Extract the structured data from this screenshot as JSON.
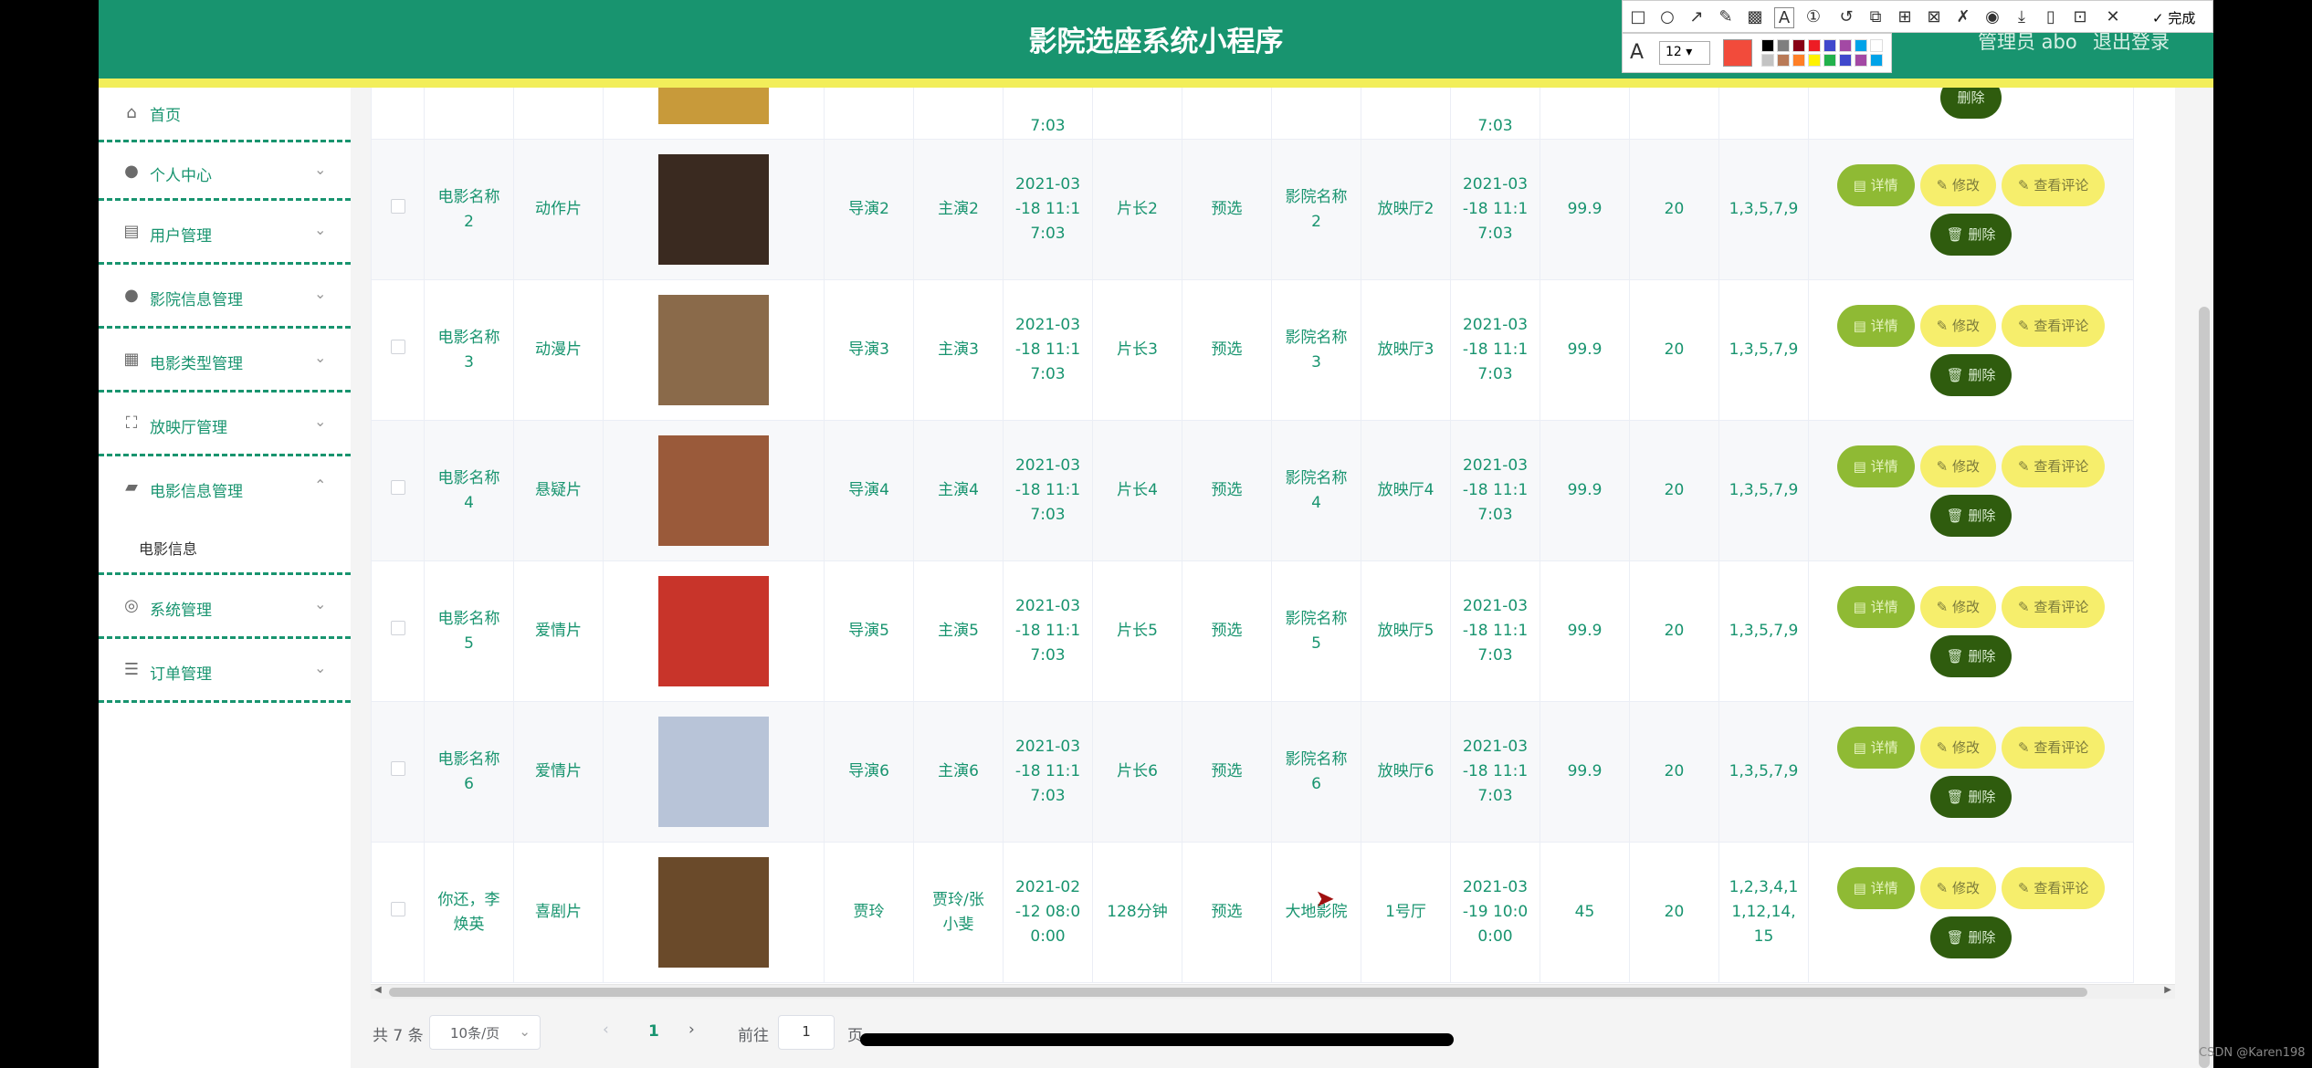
{
  "header": {
    "title": "影院选座系统小程序",
    "admin": "管理员 abo",
    "logout": "退出登录"
  },
  "sidebar": {
    "items": [
      {
        "label": "首页",
        "icon": "home-icon"
      },
      {
        "label": "个人中心",
        "icon": "user-icon"
      },
      {
        "label": "用户管理",
        "icon": "chart-icon"
      },
      {
        "label": "影院信息管理",
        "icon": "person-icon"
      },
      {
        "label": "电影类型管理",
        "icon": "grid-icon"
      },
      {
        "label": "放映厅管理",
        "icon": "fullscreen-icon"
      },
      {
        "label": "电影信息管理",
        "icon": "folder-icon"
      },
      {
        "label": "系统管理",
        "icon": "settings-icon"
      },
      {
        "label": "订单管理",
        "icon": "list-icon"
      }
    ],
    "sub_item": "电影信息"
  },
  "table": {
    "partial_row": {
      "time": "7:03",
      "time2": "7:03"
    },
    "rows": [
      {
        "name": "电影名称\n2",
        "type": "动作片",
        "director": "导演2",
        "actor": "主演2",
        "release": "2021-03\n-18 11:1\n7:03",
        "length": "片长2",
        "status": "预选",
        "cinema": "影院名称\n2",
        "hall": "放映厅2",
        "showtime": "2021-03\n-18 11:1\n7:03",
        "price": "99.9",
        "count": "20",
        "seats": "1,3,5,7,9",
        "poster": "#3a2a20"
      },
      {
        "name": "电影名称\n3",
        "type": "动漫片",
        "director": "导演3",
        "actor": "主演3",
        "release": "2021-03\n-18 11:1\n7:03",
        "length": "片长3",
        "status": "预选",
        "cinema": "影院名称\n3",
        "hall": "放映厅3",
        "showtime": "2021-03\n-18 11:1\n7:03",
        "price": "99.9",
        "count": "20",
        "seats": "1,3,5,7,9",
        "poster": "#8a6a4a"
      },
      {
        "name": "电影名称\n4",
        "type": "悬疑片",
        "director": "导演4",
        "actor": "主演4",
        "release": "2021-03\n-18 11:1\n7:03",
        "length": "片长4",
        "status": "预选",
        "cinema": "影院名称\n4",
        "hall": "放映厅4",
        "showtime": "2021-03\n-18 11:1\n7:03",
        "price": "99.9",
        "count": "20",
        "seats": "1,3,5,7,9",
        "poster": "#9a5a3a"
      },
      {
        "name": "电影名称\n5",
        "type": "爱情片",
        "director": "导演5",
        "actor": "主演5",
        "release": "2021-03\n-18 11:1\n7:03",
        "length": "片长5",
        "status": "预选",
        "cinema": "影院名称\n5",
        "hall": "放映厅5",
        "showtime": "2021-03\n-18 11:1\n7:03",
        "price": "99.9",
        "count": "20",
        "seats": "1,3,5,7,9",
        "poster": "#c8342a"
      },
      {
        "name": "电影名称\n6",
        "type": "爱情片",
        "director": "导演6",
        "actor": "主演6",
        "release": "2021-03\n-18 11:1\n7:03",
        "length": "片长6",
        "status": "预选",
        "cinema": "影院名称\n6",
        "hall": "放映厅6",
        "showtime": "2021-03\n-18 11:1\n7:03",
        "price": "99.9",
        "count": "20",
        "seats": "1,3,5,7,9",
        "poster": "#b8c4d8"
      },
      {
        "name": "你还，李\n焕英",
        "type": "喜剧片",
        "director": "贾玲",
        "actor": "贾玲/张\n小斐",
        "release": "2021-02\n-12 08:0\n0:00",
        "length": "128分钟",
        "status": "预选",
        "cinema": "大地影院",
        "hall": "1号厅",
        "showtime": "2021-03\n-19 10:0\n0:00",
        "price": "45",
        "count": "20",
        "seats": "1,2,3,4,1\n1,12,14,\n15",
        "poster": "#6a4a2a"
      }
    ],
    "buttons": {
      "detail": "详情",
      "edit": "修改",
      "review": "查看评论",
      "delete": "删除"
    }
  },
  "pager": {
    "total": "共 7 条",
    "page_size": "10条/页",
    "current": "1",
    "goto_label": "前往",
    "goto_value": "1",
    "page_suffix": "页"
  },
  "annotation_toolbar": {
    "done": "完成",
    "font_size": "12",
    "selected_color": "#f24b3b"
  },
  "watermark": "CSDN @Karen198"
}
